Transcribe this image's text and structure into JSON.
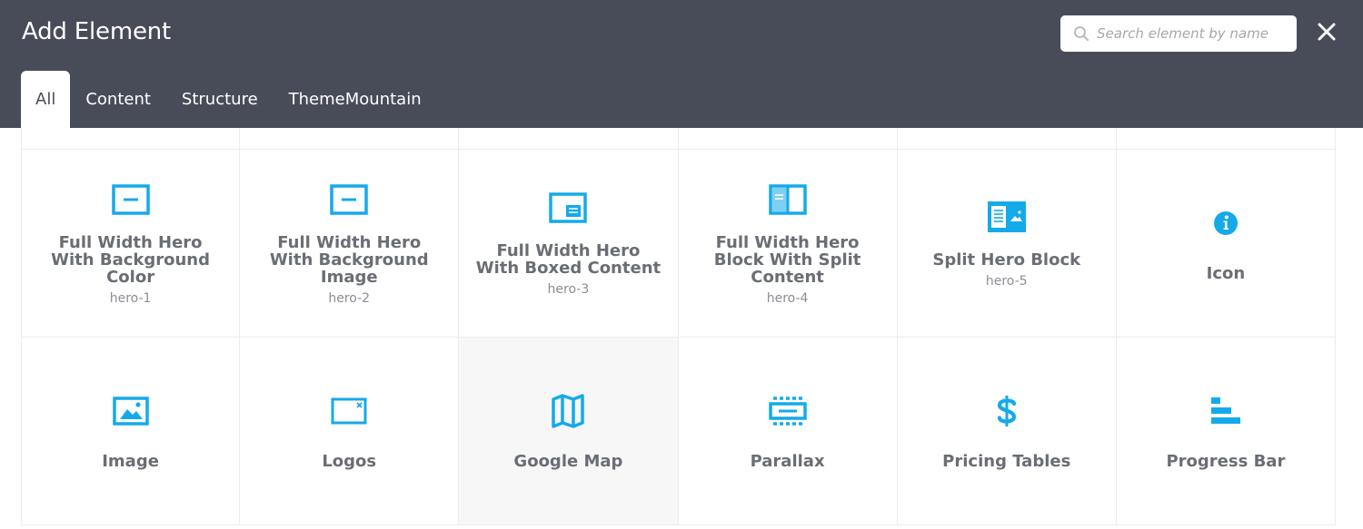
{
  "header": {
    "title": "Add Element",
    "search": {
      "placeholder": "Search element by name",
      "value": ""
    },
    "close_icon": "close-icon"
  },
  "tabs": [
    {
      "label": "All",
      "active": true
    },
    {
      "label": "Content",
      "active": false
    },
    {
      "label": "Structure",
      "active": false
    },
    {
      "label": "ThemeMountain",
      "active": false
    }
  ],
  "colors": {
    "header_bg": "#484c58",
    "icon_accent": "#14aaea",
    "text": "#6a6e74"
  },
  "elements": [
    {
      "name": "Full Width Hero With Background Color",
      "tag": "hero-1",
      "icon": "hero-fullwidth-icon"
    },
    {
      "name": "Full Width Hero With Background Image",
      "tag": "hero-2",
      "icon": "hero-fullwidth-icon"
    },
    {
      "name": "Full Width Hero With Boxed Content",
      "tag": "hero-3",
      "icon": "hero-boxed-icon"
    },
    {
      "name": "Full Width Hero Block With Split Content",
      "tag": "hero-4",
      "icon": "hero-split-icon"
    },
    {
      "name": "Split Hero Block",
      "tag": "hero-5",
      "icon": "split-hero-block-icon"
    },
    {
      "name": "Icon",
      "tag": "",
      "icon": "info-icon"
    },
    {
      "name": "Image",
      "tag": "",
      "icon": "image-icon"
    },
    {
      "name": "Logos",
      "tag": "",
      "icon": "logos-icon"
    },
    {
      "name": "Google Map",
      "tag": "",
      "icon": "map-icon"
    },
    {
      "name": "Parallax",
      "tag": "",
      "icon": "parallax-icon"
    },
    {
      "name": "Pricing Tables",
      "tag": "",
      "icon": "dollar-icon"
    },
    {
      "name": "Progress Bar",
      "tag": "",
      "icon": "progress-bar-icon"
    }
  ]
}
